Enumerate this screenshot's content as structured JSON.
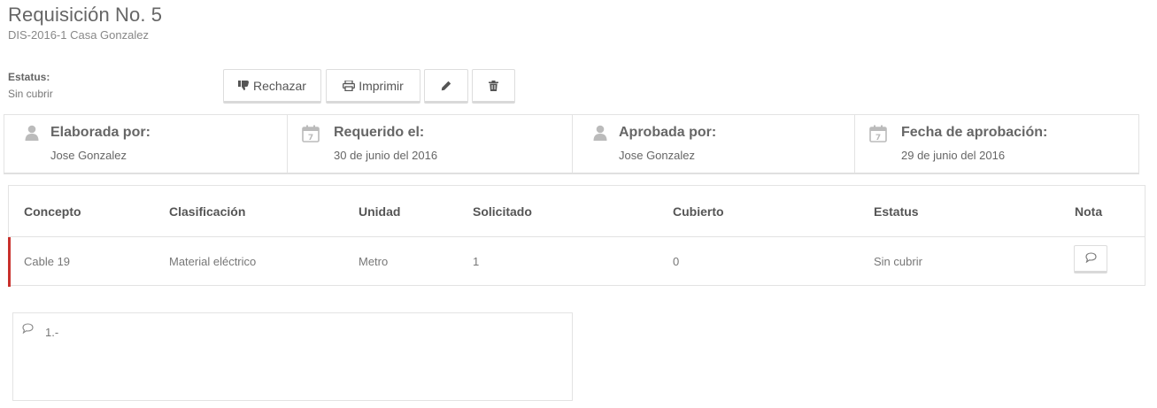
{
  "header": {
    "title": "Requisición No. 5",
    "subtitle": "DIS-2016-1 Casa Gonzalez"
  },
  "status": {
    "label": "Estatus:",
    "value": "Sin cubrir"
  },
  "toolbar": {
    "reject_label": "Rechazar",
    "print_label": "Imprimir",
    "reject_icon": "thumbs-down-icon",
    "print_icon": "printer-icon",
    "edit_icon": "pencil-icon",
    "delete_icon": "trash-icon"
  },
  "info": [
    {
      "label": "Elaborada por:",
      "value": "Jose Gonzalez",
      "icon": "user-icon"
    },
    {
      "label": "Requerido el:",
      "value": "30 de junio del 2016",
      "icon": "calendar-icon"
    },
    {
      "label": "Aprobada por:",
      "value": "Jose Gonzalez",
      "icon": "user-icon"
    },
    {
      "label": "Fecha de aprobación:",
      "value": "29 de junio del 2016",
      "icon": "calendar-icon"
    }
  ],
  "table": {
    "headers": [
      "Concepto",
      "Clasificación",
      "Unidad",
      "Solicitado",
      "Cubierto",
      "Estatus",
      "Nota"
    ],
    "rows": [
      [
        "Cable 19",
        "Material eléctrico",
        "Metro",
        "1",
        "0",
        "Sin cubrir"
      ]
    ],
    "note_icon": "comment-icon"
  },
  "notes": {
    "icon": "comment-icon",
    "text": "1.-"
  },
  "colors": {
    "row_accent": "#c9302c",
    "border": "#e3e3e3",
    "icon_gray": "#bbbbbb"
  }
}
